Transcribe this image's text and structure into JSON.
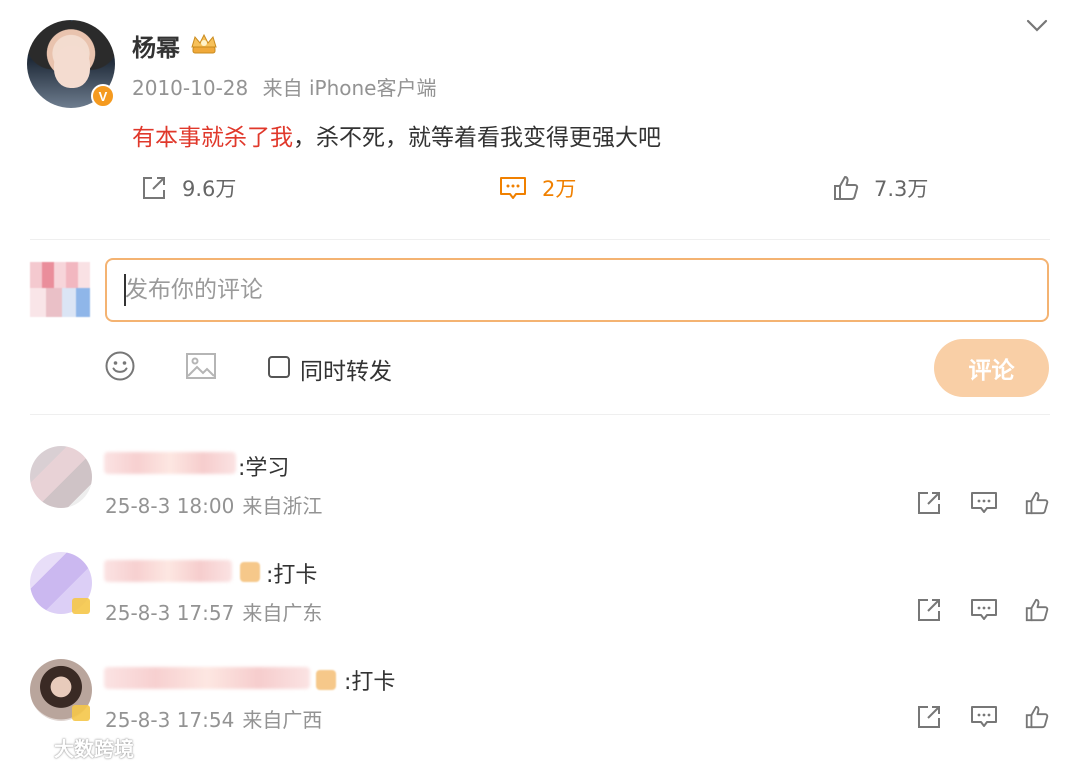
{
  "post": {
    "author": "杨幂",
    "verified_badge": "V",
    "date": "2010-10-28",
    "source": "来自 iPhone客户端",
    "text_highlight": "有本事就杀了我",
    "text_rest": "，杀不死，就等着看我变得更强大吧"
  },
  "actions": {
    "repost_count": "9.6万",
    "comment_count": "2万",
    "like_count": "7.3万"
  },
  "composer": {
    "placeholder": "发布你的评论",
    "also_repost_label": "同时转发",
    "submit_label": "评论"
  },
  "comments": [
    {
      "text": ":学习",
      "date": "25-8-3 18:00",
      "location": "来自浙江"
    },
    {
      "text": ":打卡",
      "date": "25-8-3 17:57",
      "location": "来自广东"
    },
    {
      "text": ":打卡",
      "date": "25-8-3 17:54",
      "location": "来自广西"
    }
  ],
  "watermark": "大数跨境",
  "colors": {
    "accent": "#f08000",
    "highlight_red": "#e0382b",
    "input_border": "#f4b372",
    "submit_bg": "#f9cfa6",
    "meta_gray": "#939393"
  }
}
